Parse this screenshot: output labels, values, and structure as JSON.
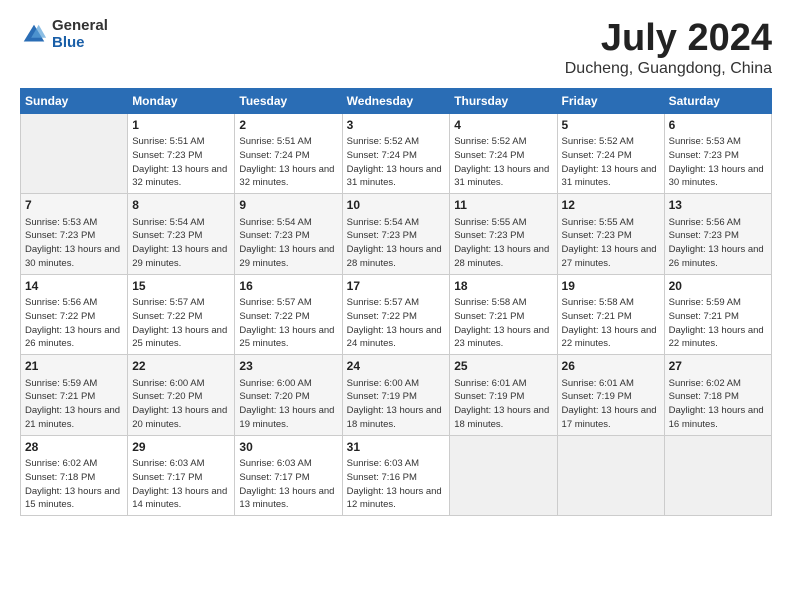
{
  "header": {
    "logo_general": "General",
    "logo_blue": "Blue",
    "month_title": "July 2024",
    "location": "Ducheng, Guangdong, China"
  },
  "days_of_week": [
    "Sunday",
    "Monday",
    "Tuesday",
    "Wednesday",
    "Thursday",
    "Friday",
    "Saturday"
  ],
  "weeks": [
    [
      {
        "day": "",
        "empty": true
      },
      {
        "day": "1",
        "sunrise": "Sunrise: 5:51 AM",
        "sunset": "Sunset: 7:23 PM",
        "daylight": "Daylight: 13 hours and 32 minutes."
      },
      {
        "day": "2",
        "sunrise": "Sunrise: 5:51 AM",
        "sunset": "Sunset: 7:24 PM",
        "daylight": "Daylight: 13 hours and 32 minutes."
      },
      {
        "day": "3",
        "sunrise": "Sunrise: 5:52 AM",
        "sunset": "Sunset: 7:24 PM",
        "daylight": "Daylight: 13 hours and 31 minutes."
      },
      {
        "day": "4",
        "sunrise": "Sunrise: 5:52 AM",
        "sunset": "Sunset: 7:24 PM",
        "daylight": "Daylight: 13 hours and 31 minutes."
      },
      {
        "day": "5",
        "sunrise": "Sunrise: 5:52 AM",
        "sunset": "Sunset: 7:24 PM",
        "daylight": "Daylight: 13 hours and 31 minutes."
      },
      {
        "day": "6",
        "sunrise": "Sunrise: 5:53 AM",
        "sunset": "Sunset: 7:23 PM",
        "daylight": "Daylight: 13 hours and 30 minutes."
      }
    ],
    [
      {
        "day": "7",
        "sunrise": "Sunrise: 5:53 AM",
        "sunset": "Sunset: 7:23 PM",
        "daylight": "Daylight: 13 hours and 30 minutes."
      },
      {
        "day": "8",
        "sunrise": "Sunrise: 5:54 AM",
        "sunset": "Sunset: 7:23 PM",
        "daylight": "Daylight: 13 hours and 29 minutes."
      },
      {
        "day": "9",
        "sunrise": "Sunrise: 5:54 AM",
        "sunset": "Sunset: 7:23 PM",
        "daylight": "Daylight: 13 hours and 29 minutes."
      },
      {
        "day": "10",
        "sunrise": "Sunrise: 5:54 AM",
        "sunset": "Sunset: 7:23 PM",
        "daylight": "Daylight: 13 hours and 28 minutes."
      },
      {
        "day": "11",
        "sunrise": "Sunrise: 5:55 AM",
        "sunset": "Sunset: 7:23 PM",
        "daylight": "Daylight: 13 hours and 28 minutes."
      },
      {
        "day": "12",
        "sunrise": "Sunrise: 5:55 AM",
        "sunset": "Sunset: 7:23 PM",
        "daylight": "Daylight: 13 hours and 27 minutes."
      },
      {
        "day": "13",
        "sunrise": "Sunrise: 5:56 AM",
        "sunset": "Sunset: 7:23 PM",
        "daylight": "Daylight: 13 hours and 26 minutes."
      }
    ],
    [
      {
        "day": "14",
        "sunrise": "Sunrise: 5:56 AM",
        "sunset": "Sunset: 7:22 PM",
        "daylight": "Daylight: 13 hours and 26 minutes."
      },
      {
        "day": "15",
        "sunrise": "Sunrise: 5:57 AM",
        "sunset": "Sunset: 7:22 PM",
        "daylight": "Daylight: 13 hours and 25 minutes."
      },
      {
        "day": "16",
        "sunrise": "Sunrise: 5:57 AM",
        "sunset": "Sunset: 7:22 PM",
        "daylight": "Daylight: 13 hours and 25 minutes."
      },
      {
        "day": "17",
        "sunrise": "Sunrise: 5:57 AM",
        "sunset": "Sunset: 7:22 PM",
        "daylight": "Daylight: 13 hours and 24 minutes."
      },
      {
        "day": "18",
        "sunrise": "Sunrise: 5:58 AM",
        "sunset": "Sunset: 7:21 PM",
        "daylight": "Daylight: 13 hours and 23 minutes."
      },
      {
        "day": "19",
        "sunrise": "Sunrise: 5:58 AM",
        "sunset": "Sunset: 7:21 PM",
        "daylight": "Daylight: 13 hours and 22 minutes."
      },
      {
        "day": "20",
        "sunrise": "Sunrise: 5:59 AM",
        "sunset": "Sunset: 7:21 PM",
        "daylight": "Daylight: 13 hours and 22 minutes."
      }
    ],
    [
      {
        "day": "21",
        "sunrise": "Sunrise: 5:59 AM",
        "sunset": "Sunset: 7:21 PM",
        "daylight": "Daylight: 13 hours and 21 minutes."
      },
      {
        "day": "22",
        "sunrise": "Sunrise: 6:00 AM",
        "sunset": "Sunset: 7:20 PM",
        "daylight": "Daylight: 13 hours and 20 minutes."
      },
      {
        "day": "23",
        "sunrise": "Sunrise: 6:00 AM",
        "sunset": "Sunset: 7:20 PM",
        "daylight": "Daylight: 13 hours and 19 minutes."
      },
      {
        "day": "24",
        "sunrise": "Sunrise: 6:00 AM",
        "sunset": "Sunset: 7:19 PM",
        "daylight": "Daylight: 13 hours and 18 minutes."
      },
      {
        "day": "25",
        "sunrise": "Sunrise: 6:01 AM",
        "sunset": "Sunset: 7:19 PM",
        "daylight": "Daylight: 13 hours and 18 minutes."
      },
      {
        "day": "26",
        "sunrise": "Sunrise: 6:01 AM",
        "sunset": "Sunset: 7:19 PM",
        "daylight": "Daylight: 13 hours and 17 minutes."
      },
      {
        "day": "27",
        "sunrise": "Sunrise: 6:02 AM",
        "sunset": "Sunset: 7:18 PM",
        "daylight": "Daylight: 13 hours and 16 minutes."
      }
    ],
    [
      {
        "day": "28",
        "sunrise": "Sunrise: 6:02 AM",
        "sunset": "Sunset: 7:18 PM",
        "daylight": "Daylight: 13 hours and 15 minutes."
      },
      {
        "day": "29",
        "sunrise": "Sunrise: 6:03 AM",
        "sunset": "Sunset: 7:17 PM",
        "daylight": "Daylight: 13 hours and 14 minutes."
      },
      {
        "day": "30",
        "sunrise": "Sunrise: 6:03 AM",
        "sunset": "Sunset: 7:17 PM",
        "daylight": "Daylight: 13 hours and 13 minutes."
      },
      {
        "day": "31",
        "sunrise": "Sunrise: 6:03 AM",
        "sunset": "Sunset: 7:16 PM",
        "daylight": "Daylight: 13 hours and 12 minutes."
      },
      {
        "day": "",
        "empty": true
      },
      {
        "day": "",
        "empty": true
      },
      {
        "day": "",
        "empty": true
      }
    ]
  ]
}
